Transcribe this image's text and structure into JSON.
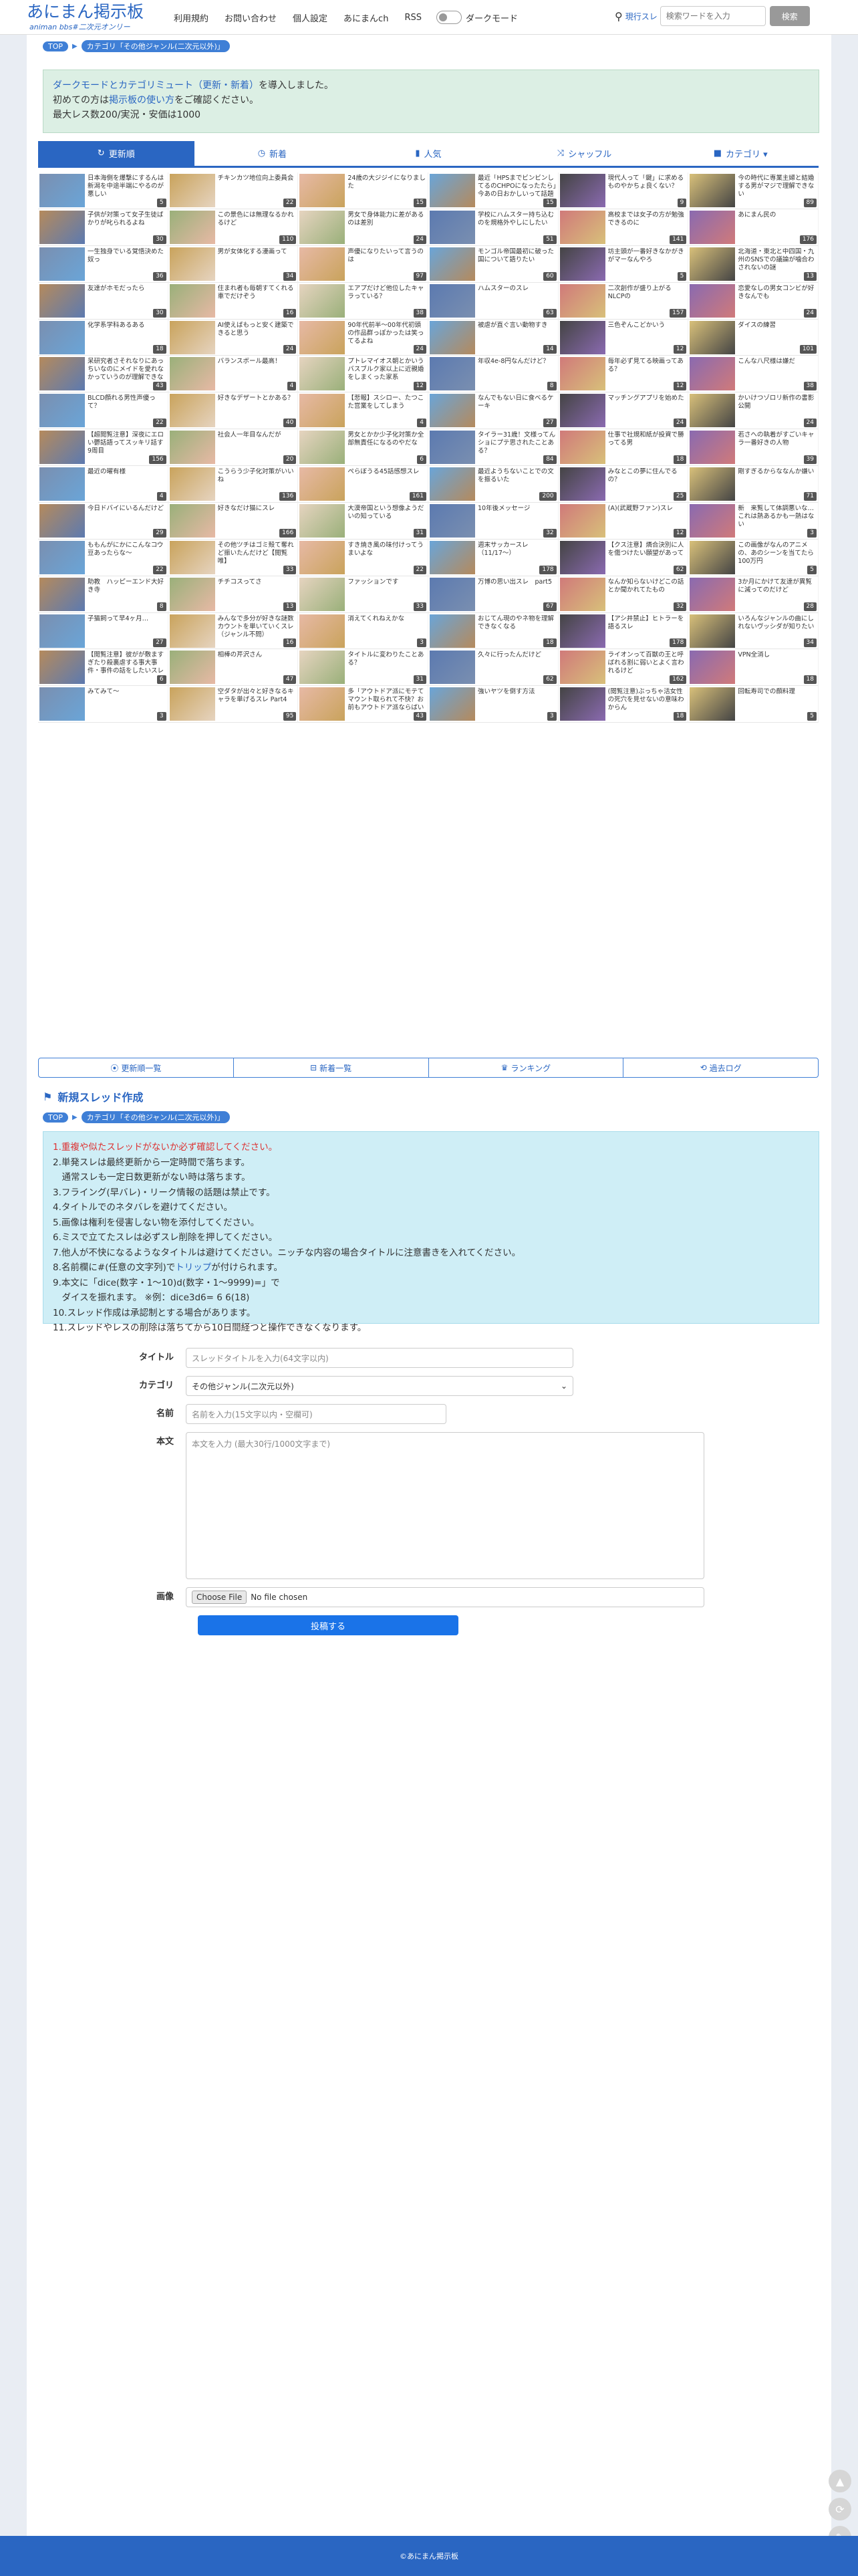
{
  "header": {
    "logo": "あにまん掲示板",
    "logo_sub": "animan bbs#二次元オンリー",
    "nav": [
      "利用規約",
      "お問い合わせ",
      "個人設定",
      "あにまんch",
      "RSS"
    ],
    "dark_mode": "ダークモード",
    "search_label": "現行スレ",
    "search_placeholder": "検索ワードを入力",
    "search_button": "検索"
  },
  "breadcrumb": {
    "top": "TOP",
    "category": "カテゴリ「その他ジャンル(二次元以外)」"
  },
  "notice": {
    "line1_link": "ダークモードとカテゴリミュート（更新・新着）",
    "line1_rest": "を導入しました。",
    "line2_pre": "初めての方は",
    "line2_link": "掲示板の使い方",
    "line2_post": "をご確認ください。",
    "line3": "最大レス数200/実況・安価は1000"
  },
  "tabs": [
    {
      "label": "更新順",
      "icon": "↻",
      "icon_name": "refresh-icon",
      "active": true
    },
    {
      "label": "新着",
      "icon": "◷",
      "icon_name": "clock-icon",
      "active": false
    },
    {
      "label": "人気",
      "icon": "▮",
      "icon_name": "bar-chart-icon",
      "active": false
    },
    {
      "label": "シャッフル",
      "icon": "⤨",
      "icon_name": "shuffle-icon",
      "active": false
    },
    {
      "label": "カテゴリ ▾",
      "icon": "■",
      "icon_name": "folder-icon",
      "active": false
    }
  ],
  "threads": [
    {
      "t": "日本海側を爆撃にするんは新潟を中途半端にやるのが悪しい",
      "c": "5"
    },
    {
      "t": "チキンカツ地位向上委員会",
      "c": "22"
    },
    {
      "t": "24歳の大ジジイになりました",
      "c": "15"
    },
    {
      "t": "最近「HPSまでビンビンしてるのCHPOになったたら」今あの日おかしいって話題あるけど",
      "c": "15"
    },
    {
      "t": "現代人って「鍵」に求めるものやかちょ良くない？",
      "c": "9"
    },
    {
      "t": "今の時代に専業主婦と結婚する男がマジで理解できない",
      "c": "89"
    },
    {
      "t": "子供が対策って女子生徒ばかりが叱られるよね",
      "c": "30"
    },
    {
      "t": "この景色には無理なるかれるけど",
      "c": "110"
    },
    {
      "t": "男女で身体能力に差があるのは差別",
      "c": "24"
    },
    {
      "t": "学校にハムスター持ち込むのを規格外やしにしたい",
      "c": "51"
    },
    {
      "t": "高校までは女子の方が勉強できるのに",
      "c": "141"
    },
    {
      "t": "あにまん民の",
      "c": "176"
    },
    {
      "t": "一生独身でいる覚悟決めた奴っ",
      "c": "36"
    },
    {
      "t": "男が女体化する漫画って",
      "c": "34"
    },
    {
      "t": "声優になりたいって言うのは",
      "c": "97"
    },
    {
      "t": "モンゴル帝国最初に破った国について語りたい",
      "c": "60"
    },
    {
      "t": "坊主頭が一番好きなかがきがマーなんやろ",
      "c": "5"
    },
    {
      "t": "北海道・東北と中四国・九州のSNSでの議論が噛合わされないの謎",
      "c": "13"
    },
    {
      "t": "友達がホモだったら",
      "c": "30"
    },
    {
      "t": "住まれ者も毎朝すてくれる車でだけぞう",
      "c": "16"
    },
    {
      "t": "エアプだけど他位したキャラっている？",
      "c": "38"
    },
    {
      "t": "ハムスターのスレ",
      "c": "63"
    },
    {
      "t": "二次創作が盛り上がるNLCPの",
      "c": "157"
    },
    {
      "t": "恋愛なしの男女コンビが好きなんでも",
      "c": "24"
    },
    {
      "t": "化学系学科あるある",
      "c": "18"
    },
    {
      "t": "AI使えばもっと安く建築できると思う",
      "c": "24"
    },
    {
      "t": "90年代前半〜00年代初頭の作品群っぽかったは笑ってるよね",
      "c": "24"
    },
    {
      "t": "被虐が直ぐ言い動物すき",
      "c": "14"
    },
    {
      "t": "三色ぞんこどかいう",
      "c": "12"
    },
    {
      "t": "ダイスの練習",
      "c": "101"
    },
    {
      "t": "呆研究者さそれなりにあっちいなのにメイドを愛れなかっていうのが理解できない",
      "c": "43"
    },
    {
      "t": "バランスボール最高！",
      "c": "4"
    },
    {
      "t": "プトレマイオス朝とかいうバスブルク家以上に近親婚をしまくった家系",
      "c": "12"
    },
    {
      "t": "年収4e-8円なんだけど？",
      "c": "8"
    },
    {
      "t": "毎年必ず見てる映画ってある？",
      "c": "12"
    },
    {
      "t": "こんな八尺様は嫌だ",
      "c": "38"
    },
    {
      "t": "BLCD顔れる男性声優って？",
      "c": "22"
    },
    {
      "t": "好きなデザートとかある？",
      "c": "40"
    },
    {
      "t": "【悲報】スシロー、たつこた営業をしてしまう",
      "c": "4"
    },
    {
      "t": "なんでもない日に食べるケーキ",
      "c": "27"
    },
    {
      "t": "マッチングアプリを始めた",
      "c": "24"
    },
    {
      "t": "かいけつゾロリ新作の書影公開",
      "c": "24"
    },
    {
      "t": "【超閲覧注意】深夜にエロい鬱話語ってスッキリ話す 9周目",
      "c": "156"
    },
    {
      "t": "社会人一年目なんだが",
      "c": "20"
    },
    {
      "t": "男女とかか少子化対策か全部無責任になるのやだな",
      "c": "6"
    },
    {
      "t": "タイラー31歳！文様ってんショにプテ思されたことある？",
      "c": "84"
    },
    {
      "t": "仕事で社規和紙が投資で勝ってる男",
      "c": "18"
    },
    {
      "t": "若さへの執着がすごいキャラ一番好きの人物",
      "c": "39"
    },
    {
      "t": "最近の曜有様",
      "c": "4"
    },
    {
      "t": "こうらう少子化対策がいいね",
      "c": "136"
    },
    {
      "t": "ぺらぼうる45話感想スレ",
      "c": "161"
    },
    {
      "t": "最近ようちないことでの文を振るいた",
      "c": "200"
    },
    {
      "t": "みなとこの夢に住んでるの？",
      "c": "25"
    },
    {
      "t": "剛すぎるからななんか嫌い",
      "c": "71"
    },
    {
      "t": "今日ドバイにいるんだけど",
      "c": "29"
    },
    {
      "t": "好きなだけ猫にスレ",
      "c": "166"
    },
    {
      "t": "大漠帝国という想像ようだいの知っている",
      "c": "31"
    },
    {
      "t": "10年後メッセージ",
      "c": "32"
    },
    {
      "t": "(A)(武蔵野ファン)スレ",
      "c": "12"
    },
    {
      "t": "新　来覧して体調悪いな…これは熱あるかも一熱はない",
      "c": "3"
    },
    {
      "t": "ももんがにかにこんなコウ豆あったらな〜",
      "c": "22"
    },
    {
      "t": "その他ツチはゴミ殻て奪れど振いたんだけど【閲覧唯】",
      "c": "33"
    },
    {
      "t": "すき焼き風の味付けってうまいよな",
      "c": "22"
    },
    {
      "t": "週末サッカースレ（11/17〜）",
      "c": "178"
    },
    {
      "t": "【クス注意】燐合決別に人を傷つけたい願望があって",
      "c": "62"
    },
    {
      "t": "この画像がなんのアニメの、あのシーンを当てたら100万円",
      "c": "5"
    },
    {
      "t": "助教　ハッピーエンド大好き寺",
      "c": "8"
    },
    {
      "t": "チチコスってさ",
      "c": "13"
    },
    {
      "t": "ファッションです",
      "c": "33"
    },
    {
      "t": "万博の思い出スレ　part5",
      "c": "67"
    },
    {
      "t": "なんか知らないけどこの話とか聞かれてたもの",
      "c": "32"
    },
    {
      "t": "3か月にかけて友達が異覧に減ってのだけど",
      "c": "28"
    },
    {
      "t": "子猫飼って早4ヶ月…",
      "c": "27"
    },
    {
      "t": "みんなで多分が好きな謎数カウントを単いていくスレ（ジャンル不問）",
      "c": "16"
    },
    {
      "t": "消えてくれねえかな",
      "c": "3"
    },
    {
      "t": "おじてん現のやネ物を理解できなくなる",
      "c": "18"
    },
    {
      "t": "【アシ井禁止】ヒトラーを語るスレ",
      "c": "178"
    },
    {
      "t": "いろんなジャンルの曲にしれないヴッシダが知りたい",
      "c": "34"
    },
    {
      "t": "【閲覧注意】彼がが敷ますぎたり殺裏虐する事大事件・事件の話をしたいスレ",
      "c": "6"
    },
    {
      "t": "相棒の芹沢さん",
      "c": "47"
    },
    {
      "t": "タイトルに変わりたことある？",
      "c": "31"
    },
    {
      "t": "久々に行ったんだけど",
      "c": "62"
    },
    {
      "t": "ライオンって百獣の王と呼ばれる割に弱いとよく言われるけど",
      "c": "162"
    },
    {
      "t": "VPN全消し",
      "c": "18"
    },
    {
      "t": "みてみて〜",
      "c": "3"
    },
    {
      "t": "空ダタが出々と好きなるキャラを単げるスレ Part4",
      "c": "95"
    },
    {
      "t": "多「アウトドア派にモテてマウント取られて不快？お前もアウトドア派ならばいいじゃん」",
      "c": "43"
    },
    {
      "t": "強いヤツを倒す方法",
      "c": "3"
    },
    {
      "t": "(閲覧注意)ぶっちゃ活女性の死穴を見せないの意味わからん",
      "c": "18"
    },
    {
      "t": "回転寿司での顔料理",
      "c": "5"
    }
  ],
  "bottom_nav": [
    {
      "label": "更新順一覧",
      "icon": "⦿",
      "icon_name": "refresh-icon"
    },
    {
      "label": "新着一覧",
      "icon": "⊟",
      "icon_name": "clock-icon"
    },
    {
      "label": "ランキング",
      "icon": "♛",
      "icon_name": "crown-icon"
    },
    {
      "label": "過去ログ",
      "icon": "⟲",
      "icon_name": "history-icon"
    }
  ],
  "new_thread": {
    "heading": "新規スレッド作成",
    "rules": [
      "1.重複や似たスレッドがないか必ず確認してください。",
      "2.単発スレは最終更新から一定時間で落ちます。",
      "　通常スレも一定日数更新がない時は落ちます。",
      "3.フライング(早バレ)・リーク情報の話題は禁止です。",
      "4.タイトルでのネタバレを避けてください。",
      "5.画像は権利を侵害しない物を添付してください。",
      "6.ミスで立てたスレは必ずスレ削除を押してください。",
      "7.他人が不快になるようなタイトルは避けてください。ニッチな内容の場合タイトルに注意書きを入れてください。",
      "8.名前欄に#(任意の文字列)でトリップが付けられます。",
      "9.本文に「dice(数字・1〜10)d(数字・1〜9999)=」で",
      "　ダイスを振れます。 ※例：dice3d6= 6 6(18)",
      "10.スレッド作成は承認制とする場合があります。",
      "11.スレッドやレスの削除は落ちてから10日間経つと操作できなくなります。"
    ],
    "title_label": "タイトル",
    "title_placeholder": "スレッドタイトルを入力(64文字以内)",
    "category_label": "カテゴリ",
    "category_value": "その他ジャンル(二次元以外)",
    "name_label": "名前",
    "name_placeholder": "名前を入力(15文字以内・空欄可)",
    "body_label": "本文",
    "body_placeholder": "本文を入力 (最大30行/1000文字まで)",
    "image_label": "画像",
    "file_button": "Choose File",
    "file_status": "No file chosen",
    "submit": "投稿する"
  },
  "footer": "©あにまん掲示板",
  "colors": {
    "accent": "#2a66c2",
    "notice_bg": "#dcefe4",
    "rules_bg": "#cfeef6",
    "footer": "#2a66c2"
  }
}
